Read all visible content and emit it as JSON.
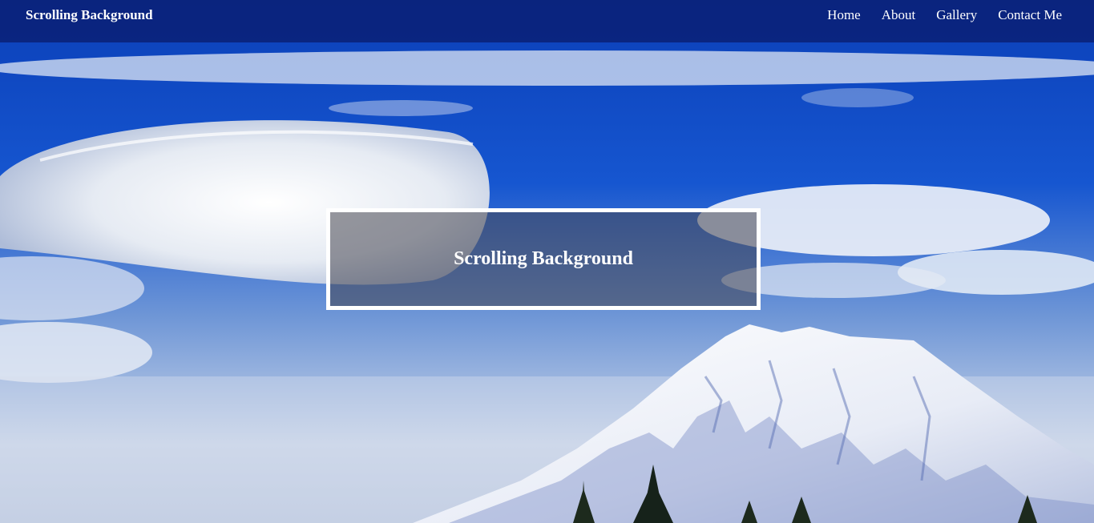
{
  "navbar": {
    "brand": "Scrolling Background",
    "links": [
      "Home",
      "About",
      "Gallery",
      "Contact Me"
    ]
  },
  "hero": {
    "title": "Scrolling Background"
  },
  "colors": {
    "navbar_bg": "#0a1c6e",
    "sky_top": "#0b3fb8",
    "sky_mid": "#1a5fd8",
    "cloud": "#e8eef7",
    "snow": "#f4f6fb",
    "rock": "#3a4d9a"
  }
}
